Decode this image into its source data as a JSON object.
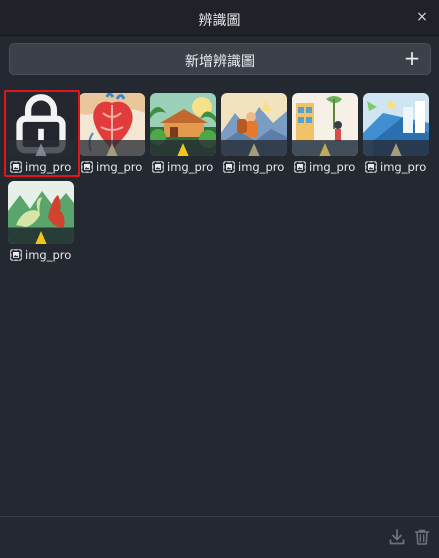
{
  "window": {
    "title": "辨識圖",
    "close_glyph": "×"
  },
  "add_bar": {
    "label": "新增辨識圖",
    "plus_glyph": "+"
  },
  "colors": {
    "background": "#242830",
    "titlebar": "#1f2228",
    "add_bar": "#3b4049",
    "star_filled": "#f2c51c",
    "star_empty": "#8a8f99",
    "selection": "#e0161c"
  },
  "items": [
    {
      "name": "img_pro",
      "stars": 0,
      "locked": true,
      "selected": true,
      "icon": "lock-icon"
    },
    {
      "name": "img_pro",
      "stars": 1,
      "locked": false,
      "selected": false,
      "art": "anatomical-heart"
    },
    {
      "name": "img_pro",
      "stars": 3,
      "locked": false,
      "selected": false,
      "art": "jungle-hut"
    },
    {
      "name": "img_pro",
      "stars": 1,
      "locked": false,
      "selected": false,
      "art": "hiker-rocks"
    },
    {
      "name": "img_pro",
      "stars": 2,
      "locked": false,
      "selected": false,
      "art": "street-scene"
    },
    {
      "name": "img_pro",
      "stars": 1,
      "locked": false,
      "selected": false,
      "art": "city-blue"
    },
    {
      "name": "img_pro",
      "stars": 3,
      "locked": false,
      "selected": false,
      "art": "dinosaurs"
    }
  ],
  "footer": {
    "icons": [
      "download-icon",
      "trash-icon"
    ]
  }
}
